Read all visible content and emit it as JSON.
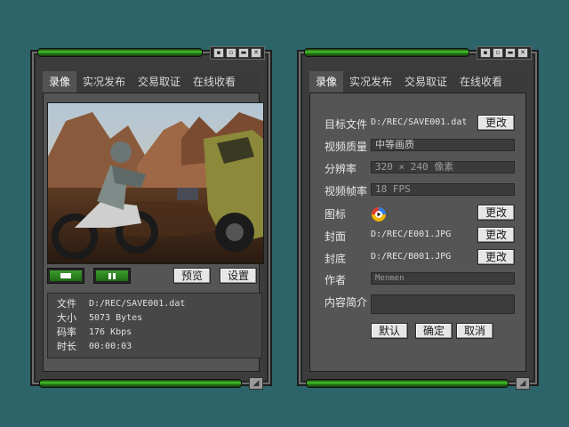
{
  "tabs": [
    "录像",
    "实况发布",
    "交易取证",
    "在线收看"
  ],
  "left": {
    "info": {
      "rows": [
        {
          "label": "文件",
          "value": "D:/REC/SAVE001.dat"
        },
        {
          "label": "大小",
          "value": "5073 Bytes"
        },
        {
          "label": "码率",
          "value": "176 Kbps"
        },
        {
          "label": "时长",
          "value": "00:00:03"
        }
      ]
    },
    "buttons": {
      "preview": "预览",
      "settings": "设置"
    }
  },
  "right": {
    "target_file": {
      "label": "目标文件",
      "value": "D:/REC/SAVE001.dat",
      "button": "更改"
    },
    "video_quality": {
      "label": "视频质量",
      "value": "中等画质"
    },
    "resolution": {
      "label": "分辨率",
      "value": "320 × 240 像素"
    },
    "framerate": {
      "label": "视频帧率",
      "value": "18 FPS"
    },
    "icon": {
      "label": "图标",
      "button": "更改"
    },
    "cover": {
      "label": "封面",
      "value": "D:/REC/E001.JPG",
      "button": "更改"
    },
    "back_cover": {
      "label": "封底",
      "value": "D:/REC/B001.JPG",
      "button": "更改"
    },
    "author": {
      "label": "作者",
      "value": "Menmen"
    },
    "summary": {
      "label": "内容简介",
      "value": ""
    },
    "buttons": {
      "default": "默认",
      "ok": "确定",
      "cancel": "取消"
    }
  },
  "icons": {
    "window_lock": "lock-icon",
    "window_restore": "restore-icon",
    "window_minimize": "minimize-icon",
    "window_close": "close-icon",
    "resize": "resize-grip-icon",
    "stop": "stop-icon",
    "pause": "pause-icon",
    "media_app": "media-app-icon"
  },
  "colors": {
    "background": "#2d6469",
    "panel": "#3c3c3c",
    "accent_green": "#47d12a"
  }
}
